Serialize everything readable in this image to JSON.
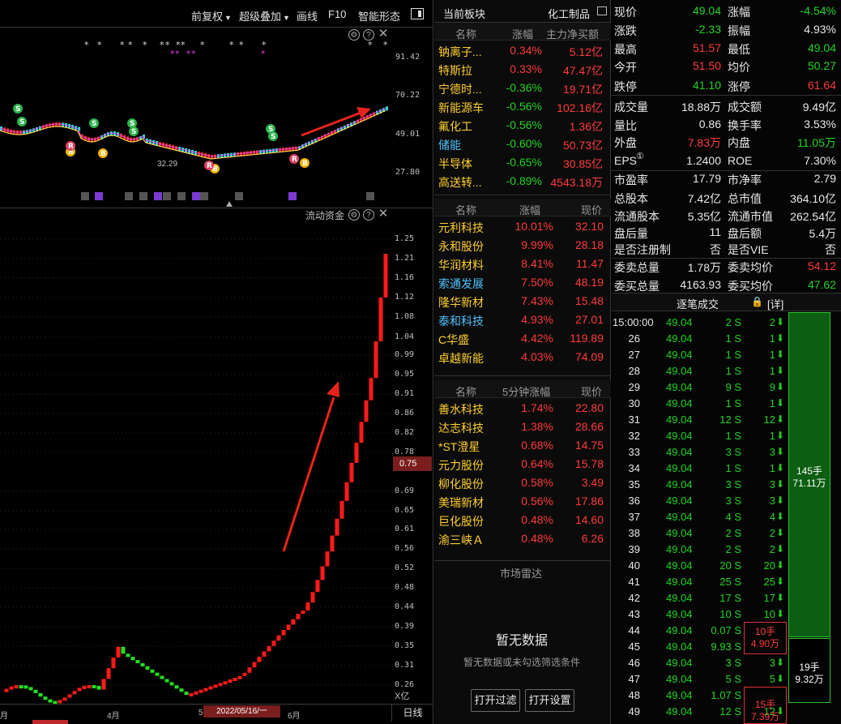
{
  "toolbar": {
    "items": [
      "前复权",
      "超级叠加",
      "画线",
      "F10",
      "智能形态"
    ]
  },
  "kline": {
    "y_labels": [
      "91.42",
      "70.22",
      "49.01",
      "27.80"
    ],
    "low_label": "32.29",
    "close_icon": "close-icon",
    "signals": {
      "buy": "B",
      "sell": "S",
      "risk": "R"
    }
  },
  "flow": {
    "title": "流动资金",
    "y_labels": [
      "1.25",
      "1.21",
      "1.16",
      "1.12",
      "1.08",
      "1.04",
      "0.99",
      "0.95",
      "0.91",
      "0.86",
      "0.82",
      "0.78",
      "0.69",
      "0.65",
      "0.61",
      "0.56",
      "0.52",
      "0.48",
      "0.44",
      "0.39",
      "0.35",
      "0.31",
      "0.26"
    ],
    "current_tag": "0.75",
    "unit": "X亿"
  },
  "xaxis": {
    "labels": [
      "月",
      "4月",
      "5",
      "6月"
    ],
    "cursor_date": "2022/05/16/一",
    "period": "日线"
  },
  "sector": {
    "header": "当前板块",
    "name": "化工制品",
    "cols": [
      "名称",
      "涨幅",
      "主力净买额"
    ],
    "rows": [
      {
        "name": "钠离子...",
        "pct": "0.34%",
        "val": "5.12亿",
        "nc": "yellow",
        "pc": "red",
        "vc": "red"
      },
      {
        "name": "特斯拉",
        "pct": "0.33%",
        "val": "47.47亿",
        "nc": "yellow",
        "pc": "red",
        "vc": "red"
      },
      {
        "name": "宁德时...",
        "pct": "-0.36%",
        "val": "19.71亿",
        "nc": "yellow",
        "pc": "green",
        "vc": "red"
      },
      {
        "name": "新能源车",
        "pct": "-0.56%",
        "val": "102.16亿",
        "nc": "yellow",
        "pc": "green",
        "vc": "red"
      },
      {
        "name": "氟化工",
        "pct": "-0.56%",
        "val": "1.36亿",
        "nc": "yellow",
        "pc": "green",
        "vc": "red"
      },
      {
        "name": "储能",
        "pct": "-0.60%",
        "val": "50.73亿",
        "nc": "cyan",
        "pc": "green",
        "vc": "red"
      },
      {
        "name": "半导体",
        "pct": "-0.65%",
        "val": "30.85亿",
        "nc": "yellow",
        "pc": "green",
        "vc": "red"
      },
      {
        "name": "高送转...",
        "pct": "-0.89%",
        "val": "4543.18万",
        "nc": "yellow",
        "pc": "green",
        "vc": "red"
      }
    ]
  },
  "gainers": {
    "cols": [
      "名称",
      "涨幅",
      "现价"
    ],
    "rows": [
      {
        "name": "元利科技",
        "pct": "10.01%",
        "price": "32.10",
        "nc": "yellow"
      },
      {
        "name": "永和股份",
        "pct": "9.99%",
        "price": "28.18",
        "nc": "yellow"
      },
      {
        "name": "华润材料",
        "pct": "8.41%",
        "price": "11.47",
        "nc": "yellow"
      },
      {
        "name": "索通发展",
        "pct": "7.50%",
        "price": "48.19",
        "nc": "cyan"
      },
      {
        "name": "隆华新材",
        "pct": "7.43%",
        "price": "15.48",
        "nc": "yellow"
      },
      {
        "name": "泰和科技",
        "pct": "4.93%",
        "price": "27.01",
        "nc": "cyan"
      },
      {
        "name": "C华盛",
        "pct": "4.42%",
        "price": "119.89",
        "nc": "yellow"
      },
      {
        "name": "卓越新能",
        "pct": "4.03%",
        "price": "74.09",
        "nc": "yellow"
      }
    ]
  },
  "fivemin": {
    "cols": [
      "名称",
      "5分钟涨幅",
      "现价"
    ],
    "rows": [
      {
        "name": "善水科技",
        "pct": "1.74%",
        "price": "22.80"
      },
      {
        "name": "达志科技",
        "pct": "1.38%",
        "price": "28.66"
      },
      {
        "name": "*ST澄星",
        "pct": "0.68%",
        "price": "14.75"
      },
      {
        "name": "元力股份",
        "pct": "0.64%",
        "price": "15.78"
      },
      {
        "name": "柳化股份",
        "pct": "0.58%",
        "price": "3.49"
      },
      {
        "name": "美瑞新材",
        "pct": "0.56%",
        "price": "17.86"
      },
      {
        "name": "巨化股份",
        "pct": "0.48%",
        "price": "14.60"
      },
      {
        "name": "渝三峡Ａ",
        "pct": "0.48%",
        "price": "6.26"
      }
    ]
  },
  "radar": {
    "title": "市场雷达",
    "empty": "暂无数据",
    "hint": "暂无数据或未勾选筛选条件",
    "btn_filter": "打开过滤",
    "btn_settings": "打开设置"
  },
  "quote": {
    "rows": [
      {
        "l1": "现价",
        "v1": "49.04",
        "c1": "green",
        "l2": "涨幅",
        "v2": "-4.54%",
        "c2": "green"
      },
      {
        "l1": "涨跌",
        "v1": "-2.33",
        "c1": "green",
        "l2": "振幅",
        "v2": "4.93%",
        "c2": "white"
      },
      {
        "l1": "最高",
        "v1": "51.57",
        "c1": "red",
        "l2": "最低",
        "v2": "49.04",
        "c2": "green"
      },
      {
        "l1": "今开",
        "v1": "51.50",
        "c1": "red",
        "l2": "均价",
        "v2": "50.27",
        "c2": "green"
      },
      {
        "l1": "跌停",
        "v1": "41.10",
        "c1": "green",
        "l2": "涨停",
        "v2": "61.64",
        "c2": "red"
      },
      {
        "l1": "成交量",
        "v1": "18.88万",
        "c1": "white",
        "l2": "成交额",
        "v2": "9.49亿",
        "c2": "white"
      },
      {
        "l1": "量比",
        "v1": "0.86",
        "c1": "white",
        "l2": "换手率",
        "v2": "3.53%",
        "c2": "white"
      },
      {
        "l1": "外盘",
        "v1": "7.83万",
        "c1": "red",
        "l2": "内盘",
        "v2": "11.05万",
        "c2": "green"
      },
      {
        "l1": "EPS",
        "v1": "1.2400",
        "c1": "white",
        "l2": "ROE",
        "v2": "7.30%",
        "c2": "white"
      },
      {
        "l1": "市盈率",
        "v1": "17.79",
        "c1": "white",
        "l2": "市净率",
        "v2": "2.79",
        "c2": "white"
      },
      {
        "l1": "总股本",
        "v1": "7.42亿",
        "c1": "white",
        "l2": "总市值",
        "v2": "364.10亿",
        "c2": "white"
      },
      {
        "l1": "流通股本",
        "v1": "5.35亿",
        "c1": "white",
        "l2": "流通市值",
        "v2": "262.54亿",
        "c2": "white"
      },
      {
        "l1": "盘后量",
        "v1": "11",
        "c1": "white",
        "l2": "盘后额",
        "v2": "5.4万",
        "c2": "white"
      },
      {
        "l1": "是否注册制",
        "v1": "否",
        "c1": "white",
        "l2": "是否VIE",
        "v2": "否",
        "c2": "white"
      },
      {
        "l1": "委卖总量",
        "v1": "1.78万",
        "c1": "white",
        "l2": "委卖均价",
        "v2": "54.12",
        "c2": "red"
      },
      {
        "l1": "委买总量",
        "v1": "4163.93",
        "c1": "white",
        "l2": "委买均价",
        "v2": "47.62",
        "c2": "green"
      }
    ],
    "eps_icon": "①"
  },
  "ticks": {
    "title": "逐笔成交",
    "detail": "[详]",
    "rows": [
      {
        "t": "15:00:00",
        "p": "49.04",
        "v": "2 S",
        "n": "2"
      },
      {
        "t": "26",
        "p": "49.04",
        "v": "1 S",
        "n": "1"
      },
      {
        "t": "27",
        "p": "49.04",
        "v": "1 S",
        "n": "1"
      },
      {
        "t": "28",
        "p": "49.04",
        "v": "1 S",
        "n": "1"
      },
      {
        "t": "29",
        "p": "49.04",
        "v": "9 S",
        "n": "9"
      },
      {
        "t": "30",
        "p": "49.04",
        "v": "1 S",
        "n": "1"
      },
      {
        "t": "31",
        "p": "49.04",
        "v": "12 S",
        "n": "12"
      },
      {
        "t": "32",
        "p": "49.04",
        "v": "1 S",
        "n": "1"
      },
      {
        "t": "33",
        "p": "49.04",
        "v": "3 S",
        "n": "3"
      },
      {
        "t": "34",
        "p": "49.04",
        "v": "1 S",
        "n": "1"
      },
      {
        "t": "35",
        "p": "49.04",
        "v": "3 S",
        "n": "3"
      },
      {
        "t": "36",
        "p": "49.04",
        "v": "3 S",
        "n": "3"
      },
      {
        "t": "37",
        "p": "49.04",
        "v": "4 S",
        "n": "4"
      },
      {
        "t": "38",
        "p": "49.04",
        "v": "2 S",
        "n": "2"
      },
      {
        "t": "39",
        "p": "49.04",
        "v": "2 S",
        "n": "2"
      },
      {
        "t": "40",
        "p": "49.04",
        "v": "20 S",
        "n": "20"
      },
      {
        "t": "41",
        "p": "49.04",
        "v": "25 S",
        "n": "25"
      },
      {
        "t": "42",
        "p": "49.04",
        "v": "17 S",
        "n": "17"
      },
      {
        "t": "43",
        "p": "49.04",
        "v": "10 S",
        "n": "10"
      },
      {
        "t": "44",
        "p": "49.04",
        "v": "0.07 S",
        "n": ""
      },
      {
        "t": "45",
        "p": "49.04",
        "v": "9.93 S",
        "n": ""
      },
      {
        "t": "46",
        "p": "49.04",
        "v": "3 S",
        "n": "3"
      },
      {
        "t": "47",
        "p": "49.04",
        "v": "5 S",
        "n": "5"
      },
      {
        "t": "48",
        "p": "49.04",
        "v": "1.07 S",
        "n": ""
      },
      {
        "t": "49",
        "p": "49.04",
        "v": "12 S",
        "n": "12"
      }
    ],
    "big1": {
      "hands": "145手",
      "amount": "71.11万"
    },
    "big2": {
      "hands": "19手",
      "amount": "9.32万"
    },
    "box1": {
      "hands": "10手",
      "amount": "4.90万"
    },
    "box2": {
      "hands": "15手",
      "amount": "7.39万"
    }
  },
  "colors": {
    "up": "#ff3b3b",
    "down": "#22d322",
    "accent": "#ffcf2f",
    "bg": "#000000"
  }
}
